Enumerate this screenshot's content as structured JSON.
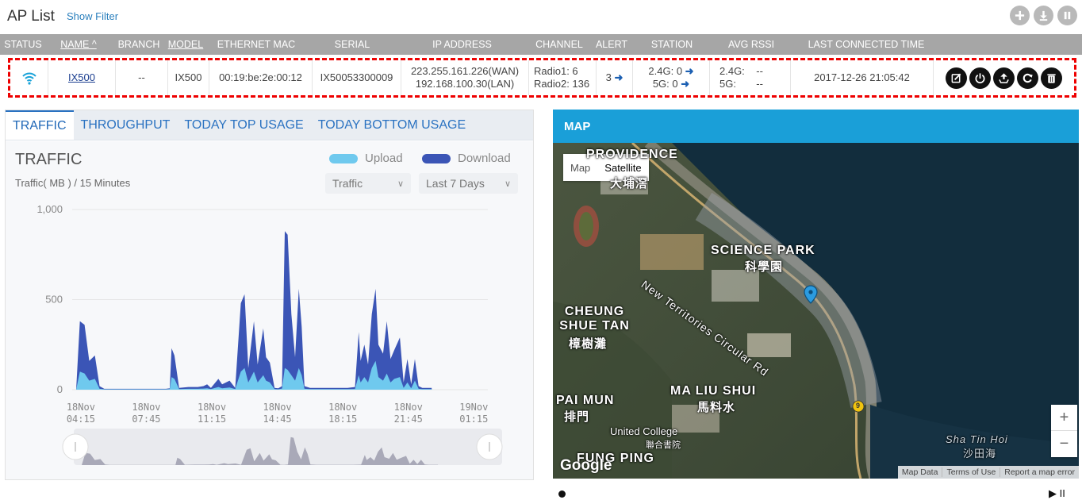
{
  "header": {
    "title": "AP List",
    "show_filter": "Show Filter",
    "icons": [
      "plus-icon",
      "download-icon",
      "pause-icon"
    ]
  },
  "table": {
    "columns": [
      {
        "label": "STATUS",
        "underline": false
      },
      {
        "label": "NAME ^",
        "underline": true
      },
      {
        "label": "BRANCH",
        "underline": false
      },
      {
        "label": "MODEL",
        "underline": true
      },
      {
        "label": "ETHERNET MAC",
        "underline": false
      },
      {
        "label": "SERIAL",
        "underline": false
      },
      {
        "label": "IP ADDRESS",
        "underline": false
      },
      {
        "label": "CHANNEL",
        "underline": false
      },
      {
        "label": "ALERT",
        "underline": false
      },
      {
        "label": "STATION",
        "underline": false
      },
      {
        "label": "AVG RSSI",
        "underline": false
      },
      {
        "label": "LAST CONNECTED TIME",
        "underline": false
      }
    ],
    "row": {
      "status_icon": "wifi-icon",
      "name": "IX500",
      "branch": "--",
      "model": "IX500",
      "mac": "00:19:be:2e:00:12",
      "serial": "IX50053300009",
      "ip_wan": "223.255.161.226(WAN)",
      "ip_lan": "192.168.100.30(LAN)",
      "radio1": "Radio1: 6",
      "radio2": "Radio2: 136",
      "alert": "3",
      "station_24": "2.4G:  0",
      "station_5": "5G:  0",
      "rssi_24": "2.4G:    --",
      "rssi_5": "5G:       --",
      "last_connected": "2017-12-26 21:05:42",
      "actions": [
        "edit-icon",
        "power-icon",
        "upload-icon",
        "refresh-icon",
        "trash-icon"
      ]
    }
  },
  "traffic": {
    "tabs": [
      "TRAFFIC",
      "THROUGHPUT",
      "TODAY TOP USAGE",
      "TODAY BOTTOM USAGE"
    ],
    "active_tab": "TRAFFIC",
    "title": "TRAFFIC",
    "subtitle": "Traffic( MB ) / 15 Minutes",
    "legend_upload": "Upload",
    "legend_download": "Download",
    "select_metric": "Traffic",
    "select_range": "Last 7 Days",
    "colors": {
      "upload": "#6fc9ee",
      "download": "#3b55b6",
      "navigator": "#a9a9b8"
    }
  },
  "chart_data": {
    "type": "area",
    "ylim": [
      0,
      1000
    ],
    "y_ticks": [
      "1,000",
      "500",
      "0"
    ],
    "x_tick_labels": [
      [
        "18Nov",
        "04:15"
      ],
      [
        "18Nov",
        "07:45"
      ],
      [
        "18Nov",
        "11:15"
      ],
      [
        "18Nov",
        "14:45"
      ],
      [
        "18Nov",
        "18:15"
      ],
      [
        "18Nov",
        "21:45"
      ],
      [
        "19Nov",
        "01:15"
      ]
    ],
    "x_tick_hours": [
      4.25,
      7.75,
      11.25,
      14.75,
      18.25,
      21.75,
      25.25
    ],
    "x_range_hours": [
      4.0,
      26.0
    ],
    "series": [
      {
        "name": "Download",
        "points": [
          [
            4.0,
            0
          ],
          [
            4.2,
            380
          ],
          [
            4.45,
            360
          ],
          [
            4.7,
            160
          ],
          [
            5.0,
            190
          ],
          [
            5.25,
            20
          ],
          [
            5.5,
            5
          ],
          [
            7.5,
            5
          ],
          [
            8.8,
            5
          ],
          [
            9.0,
            8
          ],
          [
            9.1,
            230
          ],
          [
            9.25,
            190
          ],
          [
            9.5,
            10
          ],
          [
            10.0,
            15
          ],
          [
            10.5,
            15
          ],
          [
            10.8,
            20
          ],
          [
            11.0,
            30
          ],
          [
            11.2,
            10
          ],
          [
            11.6,
            60
          ],
          [
            11.8,
            30
          ],
          [
            12.2,
            50
          ],
          [
            12.5,
            10
          ],
          [
            12.8,
            480
          ],
          [
            13.0,
            530
          ],
          [
            13.2,
            120
          ],
          [
            13.5,
            380
          ],
          [
            13.7,
            140
          ],
          [
            14.0,
            340
          ],
          [
            14.15,
            180
          ],
          [
            14.35,
            150
          ],
          [
            14.6,
            10
          ],
          [
            14.8,
            8
          ],
          [
            15.0,
            20
          ],
          [
            15.15,
            880
          ],
          [
            15.3,
            860
          ],
          [
            15.5,
            420
          ],
          [
            15.7,
            180
          ],
          [
            15.9,
            560
          ],
          [
            16.05,
            350
          ],
          [
            16.2,
            20
          ],
          [
            16.5,
            10
          ],
          [
            18.0,
            10
          ],
          [
            18.3,
            10
          ],
          [
            18.5,
            10
          ],
          [
            18.9,
            15
          ],
          [
            19.1,
            320
          ],
          [
            19.2,
            160
          ],
          [
            19.4,
            250
          ],
          [
            19.6,
            140
          ],
          [
            19.8,
            420
          ],
          [
            20.0,
            560
          ],
          [
            20.15,
            250
          ],
          [
            20.4,
            200
          ],
          [
            20.6,
            380
          ],
          [
            20.8,
            170
          ],
          [
            21.0,
            220
          ],
          [
            21.3,
            290
          ],
          [
            21.5,
            40
          ],
          [
            21.7,
            170
          ],
          [
            21.9,
            30
          ],
          [
            22.1,
            170
          ],
          [
            22.3,
            20
          ],
          [
            22.5,
            10
          ],
          [
            22.75,
            10
          ],
          [
            23.0,
            10
          ]
        ]
      },
      {
        "name": "Upload",
        "points": [
          [
            4.0,
            0
          ],
          [
            4.2,
            100
          ],
          [
            4.45,
            90
          ],
          [
            4.7,
            50
          ],
          [
            5.0,
            60
          ],
          [
            5.25,
            5
          ],
          [
            5.5,
            2
          ],
          [
            7.5,
            2
          ],
          [
            8.8,
            2
          ],
          [
            9.0,
            3
          ],
          [
            9.1,
            70
          ],
          [
            9.25,
            60
          ],
          [
            9.5,
            3
          ],
          [
            10.0,
            5
          ],
          [
            10.5,
            5
          ],
          [
            10.8,
            6
          ],
          [
            11.0,
            8
          ],
          [
            11.2,
            3
          ],
          [
            11.6,
            15
          ],
          [
            11.8,
            8
          ],
          [
            12.2,
            12
          ],
          [
            12.5,
            3
          ],
          [
            12.8,
            100
          ],
          [
            13.0,
            120
          ],
          [
            13.2,
            40
          ],
          [
            13.5,
            100
          ],
          [
            13.7,
            40
          ],
          [
            14.0,
            80
          ],
          [
            14.15,
            50
          ],
          [
            14.35,
            40
          ],
          [
            14.6,
            3
          ],
          [
            14.8,
            2
          ],
          [
            15.0,
            6
          ],
          [
            15.15,
            120
          ],
          [
            15.3,
            110
          ],
          [
            15.5,
            80
          ],
          [
            15.7,
            50
          ],
          [
            15.9,
            120
          ],
          [
            16.05,
            80
          ],
          [
            16.2,
            5
          ],
          [
            16.5,
            3
          ],
          [
            18.0,
            3
          ],
          [
            18.3,
            3
          ],
          [
            18.5,
            3
          ],
          [
            18.9,
            4
          ],
          [
            19.1,
            80
          ],
          [
            19.2,
            40
          ],
          [
            19.4,
            70
          ],
          [
            19.6,
            40
          ],
          [
            19.8,
            120
          ],
          [
            20.0,
            160
          ],
          [
            20.15,
            70
          ],
          [
            20.4,
            50
          ],
          [
            20.6,
            90
          ],
          [
            20.8,
            40
          ],
          [
            21.0,
            60
          ],
          [
            21.3,
            70
          ],
          [
            21.5,
            10
          ],
          [
            21.7,
            40
          ],
          [
            21.9,
            8
          ],
          [
            22.1,
            50
          ],
          [
            22.3,
            5
          ],
          [
            22.5,
            3
          ],
          [
            22.75,
            3
          ],
          [
            23.0,
            3
          ]
        ]
      }
    ]
  },
  "map": {
    "header": "MAP",
    "toggle_map": "Map",
    "toggle_satellite": "Satellite",
    "labels": {
      "providence": "PROVIDENCE",
      "providence_zh": "大埔滘",
      "science_park": "SCIENCE PARK",
      "science_park_zh": "科學園",
      "cheung_shue_tan": "CHEUNG\nSHUE TAN",
      "cheung_shue_tan_zh": "樟樹灘",
      "road": "New Territories Circular Rd",
      "ma_liu_shui": "MA LIU SHUI",
      "ma_liu_shui_zh": "馬料水",
      "pai_mun": "PAI MUN",
      "pai_mun_zh": "排門",
      "united_college": "United College",
      "united_college_zh": "聯合書院",
      "sha_tin_hoi": "Sha Tin Hoi",
      "sha_tin_hoi_zh": "沙田海",
      "fung_ping": "FUNG PING",
      "route": "9",
      "google": "Google"
    },
    "footer": [
      "Map Data",
      "Terms of Use",
      "Report a map error"
    ],
    "zoom_in": "+",
    "zoom_out": "−"
  },
  "playback": "▶ II"
}
